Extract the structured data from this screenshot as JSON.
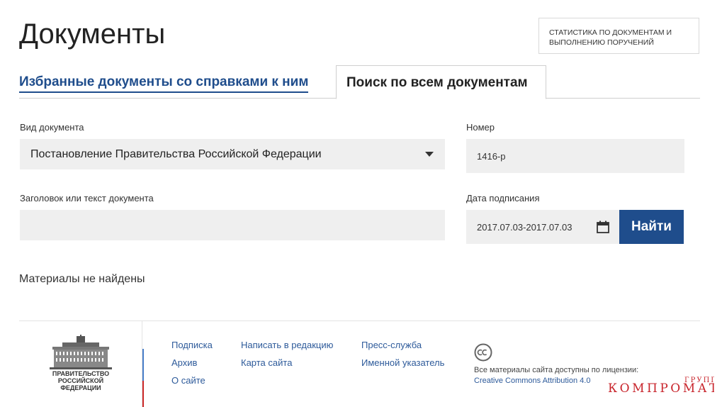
{
  "header": {
    "title": "Документы",
    "stats_line1": "Статистика по документам и",
    "stats_line2": "выполнению поручений"
  },
  "tabs": [
    {
      "label": "Избранные документы со справками к ним",
      "active": false
    },
    {
      "label": "Поиск по всем документам",
      "active": true
    }
  ],
  "form": {
    "doc_type_label": "Вид документа",
    "doc_type_value": "Постановление Правительства Российской Федерации",
    "number_label": "Номер",
    "number_value": "1416-р",
    "text_label": "Заголовок или текст документа",
    "text_value": "",
    "date_label": "Дата подписания",
    "date_value": "2017.07.03-2017.07.03",
    "find_button": "Найти"
  },
  "results": {
    "message": "Материалы не найдены"
  },
  "footer": {
    "logo_line1": "Правительство",
    "logo_line2": "Российской",
    "logo_line3": "Федерации",
    "links": [
      {
        "label": "Подписка"
      },
      {
        "label": "Архив"
      },
      {
        "label": "О сайте"
      },
      {
        "label": "Написать в редакцию"
      },
      {
        "label": "Карта сайта"
      },
      {
        "label": "Пресс-служба"
      },
      {
        "label": "Именной указатель"
      }
    ],
    "license_text": "Все материалы сайта доступны по лицензии:",
    "license_link": "Creative Commons Attribution 4.0"
  },
  "watermark": {
    "word": "КОМПРОМАТ",
    "suffix": "ГРУПП"
  },
  "colors": {
    "accent": "#1f4d8c",
    "link": "#2d5a9a",
    "field_bg": "#efefef",
    "watermark": "#c8252c"
  }
}
